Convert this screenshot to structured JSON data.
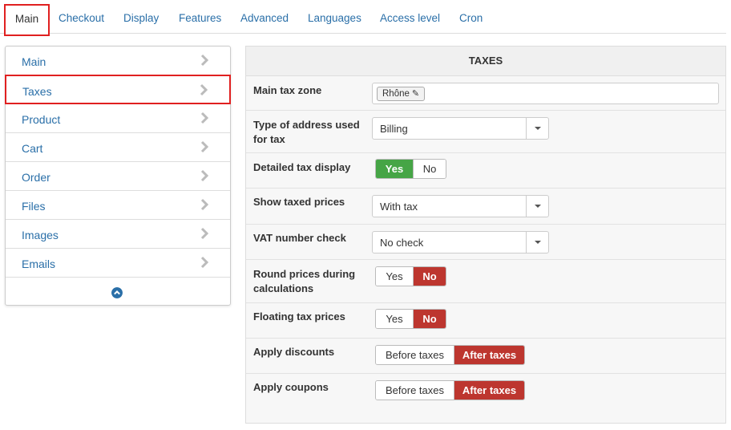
{
  "tabs": [
    "Main",
    "Checkout",
    "Display",
    "Features",
    "Advanced",
    "Languages",
    "Access level",
    "Cron"
  ],
  "side_menu": {
    "items": [
      "Main",
      "Taxes",
      "Product",
      "Cart",
      "Order",
      "Files",
      "Images",
      "Emails"
    ],
    "active": "Taxes"
  },
  "panel": {
    "title": "TAXES",
    "main_tax_zone": {
      "label": "Main tax zone",
      "tag": "Rhône"
    },
    "address_type": {
      "label": "Type of address used for tax",
      "value": "Billing"
    },
    "detailed_display": {
      "label": "Detailed tax display",
      "yes": "Yes",
      "no": "No",
      "selected": "Yes"
    },
    "show_taxed": {
      "label": "Show taxed prices",
      "value": "With tax"
    },
    "vat_check": {
      "label": "VAT number check",
      "value": "No check"
    },
    "round_prices": {
      "label": "Round prices during calculations",
      "yes": "Yes",
      "no": "No",
      "selected": "No"
    },
    "floating_tax": {
      "label": "Floating tax prices",
      "yes": "Yes",
      "no": "No",
      "selected": "No"
    },
    "apply_discounts": {
      "label": "Apply discounts",
      "before": "Before taxes",
      "after": "After taxes",
      "selected": "After taxes"
    },
    "apply_coupons": {
      "label": "Apply coupons",
      "before": "Before taxes",
      "after": "After taxes",
      "selected": "After taxes"
    }
  },
  "colors": {
    "link": "#2a6fa8",
    "highlight": "#e02020",
    "yes_active": "#46a546",
    "no_active": "#bd362f"
  }
}
